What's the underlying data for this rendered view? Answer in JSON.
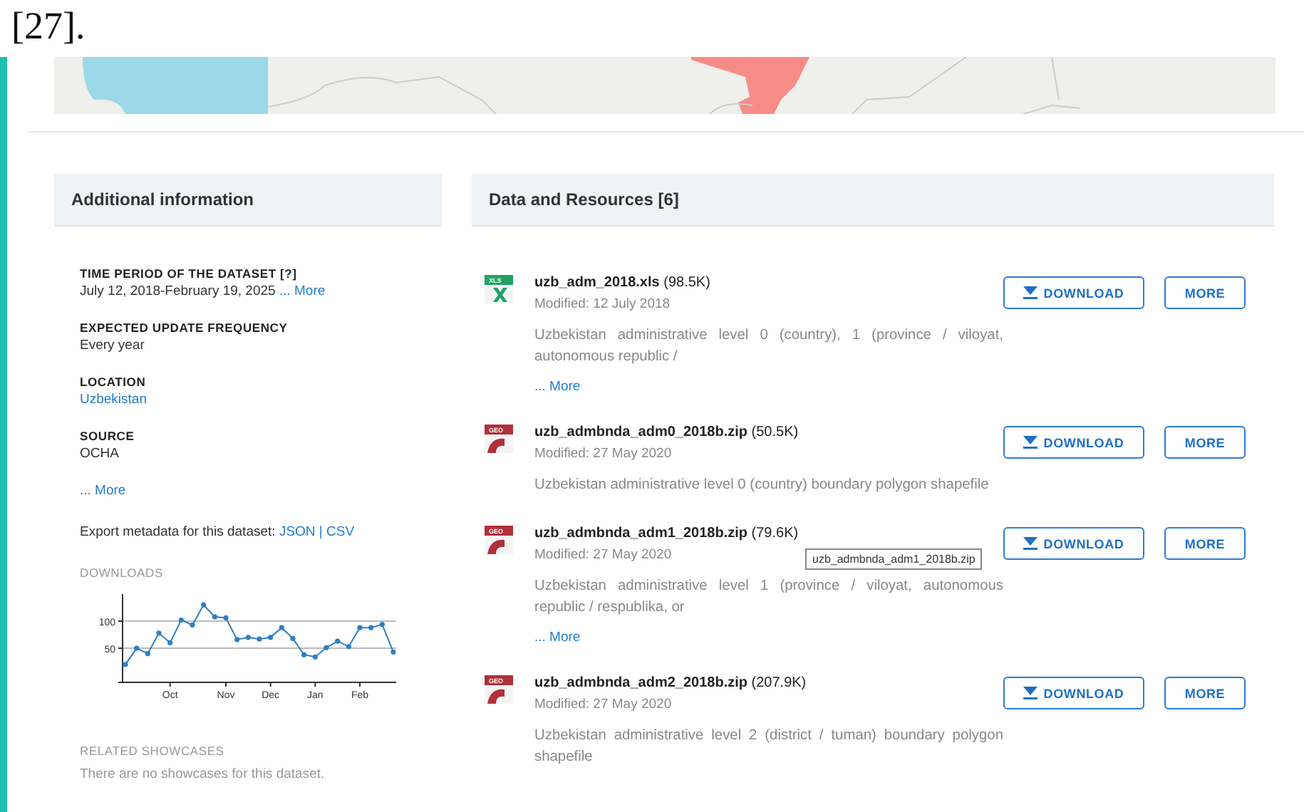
{
  "page_fragment": "[27].",
  "additional_information": {
    "title": "Additional information",
    "fields": [
      {
        "label": "TIME PERIOD OF THE DATASET [?]",
        "value": "July 12, 2018-February 19, 2025",
        "link": "... More"
      },
      {
        "label": "EXPECTED UPDATE FREQUENCY",
        "value": "Every year"
      },
      {
        "label": "LOCATION",
        "link": "Uzbekistan"
      },
      {
        "label": "SOURCE",
        "value": "OCHA"
      }
    ],
    "more_link": "... More",
    "export": {
      "text": "Export metadata for this dataset:",
      "links": [
        "JSON",
        "CSV"
      ],
      "separator": "|"
    },
    "downloads": {
      "title": "DOWNLOADS",
      "chart_data": {
        "type": "line",
        "categories": [
          null,
          null,
          null,
          null,
          "Oct",
          null,
          null,
          null,
          null,
          "Nov",
          null,
          null,
          null,
          "Dec",
          null,
          null,
          null,
          "Jan",
          null,
          null,
          null,
          "Feb",
          null,
          null,
          null
        ],
        "series": [
          {
            "marker": "circle",
            "color": "#2f7fc1",
            "values": [
              20,
              50,
              40,
              78,
              60,
              102,
              93,
              130,
              108,
              106,
              66,
              70,
              67,
              70,
              88,
              68,
              38,
              34,
              51,
              63,
              53,
              88,
              88,
              94,
              43
            ]
          }
        ],
        "ylim": [
          -13,
          150
        ],
        "yticks": [
          50,
          100
        ]
      }
    },
    "showcases": {
      "title": "RELATED SHOWCASES",
      "text": "There are no showcases for this dataset."
    }
  },
  "resources": {
    "title": "Data and Resources [6]",
    "items": [
      {
        "kind": "xls",
        "icon_label": "XLS",
        "name": "uzb_adm_2018.xls",
        "size": "(98.5K)",
        "modified": "Modified: 12 July 2018",
        "description": "Uzbekistan administrative level 0 (country), 1 (province / viloyat, autonomous republic /",
        "more": "... More",
        "download": "DOWNLOAD",
        "details": "MORE"
      },
      {
        "kind": "geo",
        "icon_label": "GEO",
        "name": "uzb_admbnda_adm0_2018b.zip",
        "size": "(50.5K)",
        "modified": "Modified: 27 May 2020",
        "description": "Uzbekistan administrative level 0 (country) boundary polygon shapefile",
        "download": "DOWNLOAD",
        "details": "MORE"
      },
      {
        "kind": "geo",
        "icon_label": "GEO",
        "name": "uzb_admbnda_adm1_2018b.zip",
        "size": "(79.6K)",
        "modified": "Modified: 27 May 2020",
        "tooltip": "uzb_admbnda_adm1_2018b.zip",
        "description": "Uzbekistan administrative level 1 (province / viloyat, autonomous republic / respublika, or",
        "more": "... More",
        "download": "DOWNLOAD",
        "details": "MORE"
      },
      {
        "kind": "geo",
        "icon_label": "GEO",
        "name": "uzb_admbnda_adm2_2018b.zip",
        "size": "(207.9K)",
        "modified": "Modified: 27 May 2020",
        "description": "Uzbekistan administrative level 2 (district / tuman) boundary polygon shapefile",
        "download": "DOWNLOAD",
        "details": "MORE"
      }
    ]
  }
}
